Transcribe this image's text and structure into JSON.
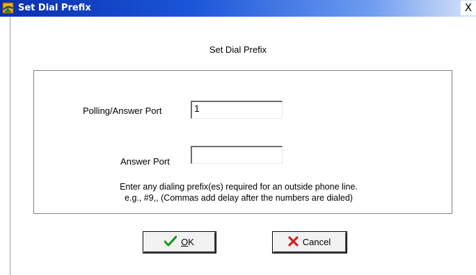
{
  "window": {
    "title": "Set Dial Prefix",
    "close_glyph": "X",
    "app_icon": "modem-app-icon"
  },
  "dialog": {
    "heading": "Set Dial Prefix",
    "polling_label": "Polling/Answer Port",
    "polling_value": "1",
    "answer_label": "Answer Port",
    "answer_value": "",
    "hint_line1": "Enter any dialing prefix(es) required for an outside phone line.",
    "hint_line2": "e.g.,  #9,, (Commas add delay after the numbers are dialed)"
  },
  "buttons": {
    "ok_mnemonic": "O",
    "ok_rest": "K",
    "ok_icon": "checkmark-icon",
    "cancel_label": "Cancel",
    "cancel_icon": "x-mark-icon"
  },
  "colors": {
    "title_bar": "#0a2fae",
    "ok_check": "#1e9a1e",
    "cancel_x": "#d42020"
  }
}
